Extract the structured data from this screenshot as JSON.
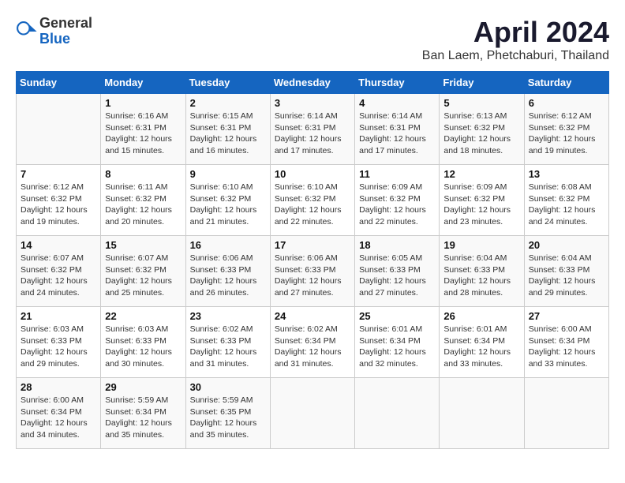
{
  "header": {
    "logo_general": "General",
    "logo_blue": "Blue",
    "month_title": "April 2024",
    "location": "Ban Laem, Phetchaburi, Thailand"
  },
  "weekdays": [
    "Sunday",
    "Monday",
    "Tuesday",
    "Wednesday",
    "Thursday",
    "Friday",
    "Saturday"
  ],
  "weeks": [
    [
      {
        "day": "",
        "info": ""
      },
      {
        "day": "1",
        "info": "Sunrise: 6:16 AM\nSunset: 6:31 PM\nDaylight: 12 hours\nand 15 minutes."
      },
      {
        "day": "2",
        "info": "Sunrise: 6:15 AM\nSunset: 6:31 PM\nDaylight: 12 hours\nand 16 minutes."
      },
      {
        "day": "3",
        "info": "Sunrise: 6:14 AM\nSunset: 6:31 PM\nDaylight: 12 hours\nand 17 minutes."
      },
      {
        "day": "4",
        "info": "Sunrise: 6:14 AM\nSunset: 6:31 PM\nDaylight: 12 hours\nand 17 minutes."
      },
      {
        "day": "5",
        "info": "Sunrise: 6:13 AM\nSunset: 6:32 PM\nDaylight: 12 hours\nand 18 minutes."
      },
      {
        "day": "6",
        "info": "Sunrise: 6:12 AM\nSunset: 6:32 PM\nDaylight: 12 hours\nand 19 minutes."
      }
    ],
    [
      {
        "day": "7",
        "info": "Sunrise: 6:12 AM\nSunset: 6:32 PM\nDaylight: 12 hours\nand 19 minutes."
      },
      {
        "day": "8",
        "info": "Sunrise: 6:11 AM\nSunset: 6:32 PM\nDaylight: 12 hours\nand 20 minutes."
      },
      {
        "day": "9",
        "info": "Sunrise: 6:10 AM\nSunset: 6:32 PM\nDaylight: 12 hours\nand 21 minutes."
      },
      {
        "day": "10",
        "info": "Sunrise: 6:10 AM\nSunset: 6:32 PM\nDaylight: 12 hours\nand 22 minutes."
      },
      {
        "day": "11",
        "info": "Sunrise: 6:09 AM\nSunset: 6:32 PM\nDaylight: 12 hours\nand 22 minutes."
      },
      {
        "day": "12",
        "info": "Sunrise: 6:09 AM\nSunset: 6:32 PM\nDaylight: 12 hours\nand 23 minutes."
      },
      {
        "day": "13",
        "info": "Sunrise: 6:08 AM\nSunset: 6:32 PM\nDaylight: 12 hours\nand 24 minutes."
      }
    ],
    [
      {
        "day": "14",
        "info": "Sunrise: 6:07 AM\nSunset: 6:32 PM\nDaylight: 12 hours\nand 24 minutes."
      },
      {
        "day": "15",
        "info": "Sunrise: 6:07 AM\nSunset: 6:32 PM\nDaylight: 12 hours\nand 25 minutes."
      },
      {
        "day": "16",
        "info": "Sunrise: 6:06 AM\nSunset: 6:33 PM\nDaylight: 12 hours\nand 26 minutes."
      },
      {
        "day": "17",
        "info": "Sunrise: 6:06 AM\nSunset: 6:33 PM\nDaylight: 12 hours\nand 27 minutes."
      },
      {
        "day": "18",
        "info": "Sunrise: 6:05 AM\nSunset: 6:33 PM\nDaylight: 12 hours\nand 27 minutes."
      },
      {
        "day": "19",
        "info": "Sunrise: 6:04 AM\nSunset: 6:33 PM\nDaylight: 12 hours\nand 28 minutes."
      },
      {
        "day": "20",
        "info": "Sunrise: 6:04 AM\nSunset: 6:33 PM\nDaylight: 12 hours\nand 29 minutes."
      }
    ],
    [
      {
        "day": "21",
        "info": "Sunrise: 6:03 AM\nSunset: 6:33 PM\nDaylight: 12 hours\nand 29 minutes."
      },
      {
        "day": "22",
        "info": "Sunrise: 6:03 AM\nSunset: 6:33 PM\nDaylight: 12 hours\nand 30 minutes."
      },
      {
        "day": "23",
        "info": "Sunrise: 6:02 AM\nSunset: 6:33 PM\nDaylight: 12 hours\nand 31 minutes."
      },
      {
        "day": "24",
        "info": "Sunrise: 6:02 AM\nSunset: 6:34 PM\nDaylight: 12 hours\nand 31 minutes."
      },
      {
        "day": "25",
        "info": "Sunrise: 6:01 AM\nSunset: 6:34 PM\nDaylight: 12 hours\nand 32 minutes."
      },
      {
        "day": "26",
        "info": "Sunrise: 6:01 AM\nSunset: 6:34 PM\nDaylight: 12 hours\nand 33 minutes."
      },
      {
        "day": "27",
        "info": "Sunrise: 6:00 AM\nSunset: 6:34 PM\nDaylight: 12 hours\nand 33 minutes."
      }
    ],
    [
      {
        "day": "28",
        "info": "Sunrise: 6:00 AM\nSunset: 6:34 PM\nDaylight: 12 hours\nand 34 minutes."
      },
      {
        "day": "29",
        "info": "Sunrise: 5:59 AM\nSunset: 6:34 PM\nDaylight: 12 hours\nand 35 minutes."
      },
      {
        "day": "30",
        "info": "Sunrise: 5:59 AM\nSunset: 6:35 PM\nDaylight: 12 hours\nand 35 minutes."
      },
      {
        "day": "",
        "info": ""
      },
      {
        "day": "",
        "info": ""
      },
      {
        "day": "",
        "info": ""
      },
      {
        "day": "",
        "info": ""
      }
    ]
  ]
}
